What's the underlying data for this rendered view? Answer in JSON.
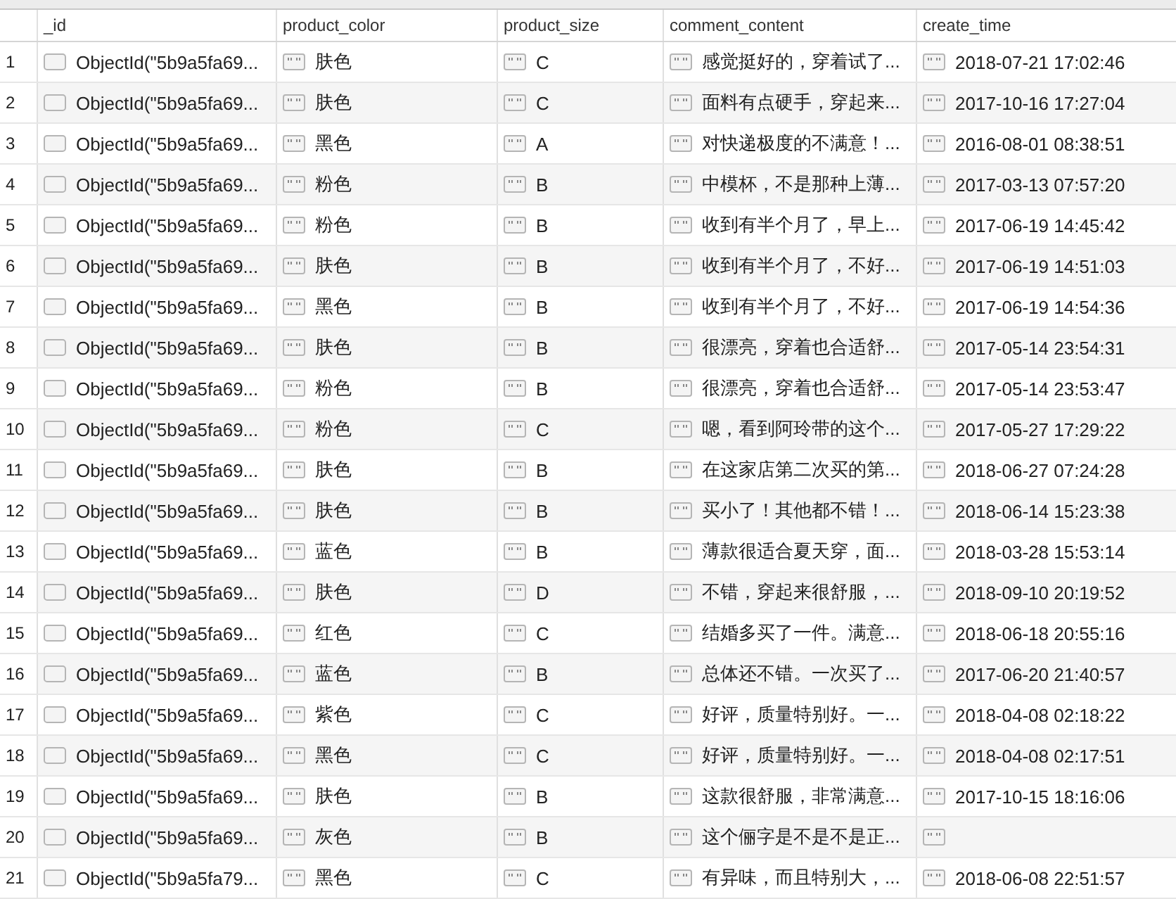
{
  "table": {
    "columns": [
      {
        "label": "_id",
        "kind": "object"
      },
      {
        "label": "product_color",
        "kind": "string"
      },
      {
        "label": "product_size",
        "kind": "string"
      },
      {
        "label": "comment_content",
        "kind": "string"
      },
      {
        "label": "create_time",
        "kind": "string"
      }
    ],
    "rows": [
      {
        "number": "1",
        "cells": [
          "ObjectId(\"5b9a5fa69...",
          "肤色",
          "C",
          "感觉挺好的，穿着试了...",
          "2018-07-21 17:02:46"
        ]
      },
      {
        "number": "2",
        "cells": [
          "ObjectId(\"5b9a5fa69...",
          "肤色",
          "C",
          "面料有点硬手，穿起来...",
          "2017-10-16 17:27:04"
        ]
      },
      {
        "number": "3",
        "cells": [
          "ObjectId(\"5b9a5fa69...",
          "黑色",
          "A",
          "对快递极度的不满意！...",
          "2016-08-01 08:38:51"
        ]
      },
      {
        "number": "4",
        "cells": [
          "ObjectId(\"5b9a5fa69...",
          "粉色",
          "B",
          "中模杯，不是那种上薄...",
          "2017-03-13 07:57:20"
        ]
      },
      {
        "number": "5",
        "cells": [
          "ObjectId(\"5b9a5fa69...",
          "粉色",
          "B",
          "收到有半个月了，早上...",
          "2017-06-19 14:45:42"
        ]
      },
      {
        "number": "6",
        "cells": [
          "ObjectId(\"5b9a5fa69...",
          "肤色",
          "B",
          "收到有半个月了，不好...",
          "2017-06-19 14:51:03"
        ]
      },
      {
        "number": "7",
        "cells": [
          "ObjectId(\"5b9a5fa69...",
          "黑色",
          "B",
          "收到有半个月了，不好...",
          "2017-06-19 14:54:36"
        ]
      },
      {
        "number": "8",
        "cells": [
          "ObjectId(\"5b9a5fa69...",
          "肤色",
          "B",
          "很漂亮，穿着也合适舒...",
          "2017-05-14 23:54:31"
        ]
      },
      {
        "number": "9",
        "cells": [
          "ObjectId(\"5b9a5fa69...",
          "粉色",
          "B",
          "很漂亮，穿着也合适舒...",
          "2017-05-14 23:53:47"
        ]
      },
      {
        "number": "10",
        "cells": [
          "ObjectId(\"5b9a5fa69...",
          "粉色",
          "C",
          "嗯，看到阿玲带的这个...",
          "2017-05-27 17:29:22"
        ]
      },
      {
        "number": "11",
        "cells": [
          "ObjectId(\"5b9a5fa69...",
          "肤色",
          "B",
          "在这家店第二次买的第...",
          "2018-06-27 07:24:28"
        ]
      },
      {
        "number": "12",
        "cells": [
          "ObjectId(\"5b9a5fa69...",
          "肤色",
          "B",
          "买小了！其他都不错！...",
          "2018-06-14 15:23:38"
        ]
      },
      {
        "number": "13",
        "cells": [
          "ObjectId(\"5b9a5fa69...",
          "蓝色",
          "B",
          "薄款很适合夏天穿，面...",
          "2018-03-28 15:53:14"
        ]
      },
      {
        "number": "14",
        "cells": [
          "ObjectId(\"5b9a5fa69...",
          "肤色",
          "D",
          "不错，穿起来很舒服，...",
          "2018-09-10 20:19:52"
        ]
      },
      {
        "number": "15",
        "cells": [
          "ObjectId(\"5b9a5fa69...",
          "红色",
          "C",
          "结婚多买了一件。满意...",
          "2018-06-18 20:55:16"
        ]
      },
      {
        "number": "16",
        "cells": [
          "ObjectId(\"5b9a5fa69...",
          "蓝色",
          "B",
          "总体还不错。一次买了...",
          "2017-06-20 21:40:57"
        ]
      },
      {
        "number": "17",
        "cells": [
          "ObjectId(\"5b9a5fa69...",
          "紫色",
          "C",
          "好评，质量特别好。一...",
          "2018-04-08 02:18:22"
        ]
      },
      {
        "number": "18",
        "cells": [
          "ObjectId(\"5b9a5fa69...",
          "黑色",
          "C",
          "好评，质量特别好。一...",
          "2018-04-08 02:17:51"
        ]
      },
      {
        "number": "19",
        "cells": [
          "ObjectId(\"5b9a5fa69...",
          "肤色",
          "B",
          "这款很舒服，非常满意...",
          "2017-10-15 18:16:06"
        ]
      },
      {
        "number": "20",
        "cells": [
          "ObjectId(\"5b9a5fa69...",
          "灰色",
          "B",
          "这个俪字是不是不是正..."
        ]
      },
      {
        "number": "21",
        "cells": [
          "ObjectId(\"5b9a5fa79...",
          "黑色",
          "C",
          "有异味，而且特别大，...",
          "2018-06-08 22:51:57"
        ]
      }
    ]
  }
}
